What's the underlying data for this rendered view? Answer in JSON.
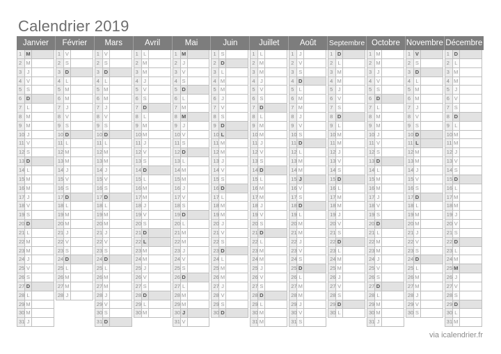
{
  "title": "Calendrier 2019",
  "footer": "via icalendrier.fr",
  "colors": {
    "header_bg": "#7d7d7d",
    "highlight_bg": "#e2e2e2",
    "day_num_bg": "#ececec"
  },
  "holidays": {
    "1": [
      1
    ],
    "4": [
      22
    ],
    "5": [
      1,
      8,
      30
    ],
    "6": [
      10
    ],
    "7": [
      14
    ],
    "8": [
      15
    ],
    "11": [
      1,
      11
    ],
    "12": [
      25
    ]
  },
  "months": [
    {
      "name": "Janvier",
      "days": [
        "M",
        "M",
        "J",
        "V",
        "S",
        "D",
        "L",
        "M",
        "M",
        "J",
        "V",
        "S",
        "D",
        "L",
        "M",
        "M",
        "J",
        "V",
        "S",
        "D",
        "L",
        "M",
        "M",
        "J",
        "V",
        "S",
        "D",
        "L",
        "M",
        "M",
        "J"
      ]
    },
    {
      "name": "Février",
      "days": [
        "V",
        "S",
        "D",
        "L",
        "M",
        "M",
        "J",
        "V",
        "S",
        "D",
        "L",
        "M",
        "M",
        "J",
        "V",
        "S",
        "D",
        "L",
        "M",
        "M",
        "J",
        "V",
        "S",
        "D",
        "L",
        "M",
        "M",
        "J"
      ]
    },
    {
      "name": "Mars",
      "days": [
        "V",
        "S",
        "D",
        "L",
        "M",
        "M",
        "J",
        "V",
        "S",
        "D",
        "L",
        "M",
        "M",
        "J",
        "V",
        "S",
        "D",
        "L",
        "M",
        "M",
        "J",
        "V",
        "S",
        "D",
        "L",
        "M",
        "M",
        "J",
        "V",
        "S",
        "D"
      ]
    },
    {
      "name": "Avril",
      "days": [
        "L",
        "M",
        "M",
        "J",
        "V",
        "S",
        "D",
        "L",
        "M",
        "M",
        "J",
        "V",
        "S",
        "D",
        "L",
        "M",
        "M",
        "J",
        "V",
        "S",
        "D",
        "L",
        "M",
        "M",
        "J",
        "V",
        "S",
        "D",
        "L",
        "M"
      ]
    },
    {
      "name": "Mai",
      "days": [
        "M",
        "J",
        "V",
        "S",
        "D",
        "L",
        "M",
        "M",
        "J",
        "V",
        "S",
        "D",
        "L",
        "M",
        "M",
        "J",
        "V",
        "S",
        "D",
        "L",
        "M",
        "M",
        "J",
        "V",
        "S",
        "D",
        "L",
        "M",
        "M",
        "J",
        "V"
      ]
    },
    {
      "name": "Juin",
      "days": [
        "S",
        "D",
        "L",
        "M",
        "M",
        "J",
        "V",
        "S",
        "D",
        "L",
        "M",
        "M",
        "J",
        "V",
        "S",
        "D",
        "L",
        "M",
        "M",
        "J",
        "V",
        "S",
        "D",
        "L",
        "M",
        "M",
        "J",
        "V",
        "S",
        "D"
      ]
    },
    {
      "name": "Juillet",
      "days": [
        "L",
        "M",
        "M",
        "J",
        "V",
        "S",
        "D",
        "L",
        "M",
        "M",
        "J",
        "V",
        "S",
        "D",
        "L",
        "M",
        "M",
        "J",
        "V",
        "S",
        "D",
        "L",
        "M",
        "M",
        "J",
        "V",
        "S",
        "D",
        "L",
        "M",
        "M"
      ]
    },
    {
      "name": "Août",
      "days": [
        "J",
        "V",
        "S",
        "D",
        "L",
        "M",
        "M",
        "J",
        "V",
        "S",
        "D",
        "L",
        "M",
        "M",
        "J",
        "V",
        "S",
        "D",
        "L",
        "M",
        "M",
        "J",
        "V",
        "S",
        "D",
        "L",
        "M",
        "M",
        "J",
        "V",
        "S"
      ]
    },
    {
      "name": "Septembre",
      "days": [
        "D",
        "L",
        "M",
        "M",
        "J",
        "V",
        "S",
        "D",
        "L",
        "M",
        "M",
        "J",
        "V",
        "S",
        "D",
        "L",
        "M",
        "M",
        "J",
        "V",
        "S",
        "D",
        "L",
        "M",
        "M",
        "J",
        "V",
        "S",
        "D",
        "L"
      ]
    },
    {
      "name": "Octobre",
      "days": [
        "M",
        "M",
        "J",
        "V",
        "S",
        "D",
        "L",
        "M",
        "M",
        "J",
        "V",
        "S",
        "D",
        "L",
        "M",
        "M",
        "J",
        "V",
        "S",
        "D",
        "L",
        "M",
        "M",
        "J",
        "V",
        "S",
        "D",
        "L",
        "M",
        "M",
        "J"
      ]
    },
    {
      "name": "Novembre",
      "days": [
        "V",
        "S",
        "D",
        "L",
        "M",
        "M",
        "J",
        "V",
        "S",
        "D",
        "L",
        "M",
        "M",
        "J",
        "V",
        "S",
        "D",
        "L",
        "M",
        "M",
        "J",
        "V",
        "S",
        "D",
        "L",
        "M",
        "M",
        "J",
        "V",
        "S"
      ]
    },
    {
      "name": "Décembre",
      "days": [
        "D",
        "L",
        "M",
        "M",
        "J",
        "V",
        "S",
        "D",
        "L",
        "M",
        "M",
        "J",
        "V",
        "S",
        "D",
        "L",
        "M",
        "M",
        "J",
        "V",
        "S",
        "D",
        "L",
        "M",
        "M",
        "J",
        "V",
        "S",
        "D",
        "L",
        "M"
      ]
    }
  ]
}
